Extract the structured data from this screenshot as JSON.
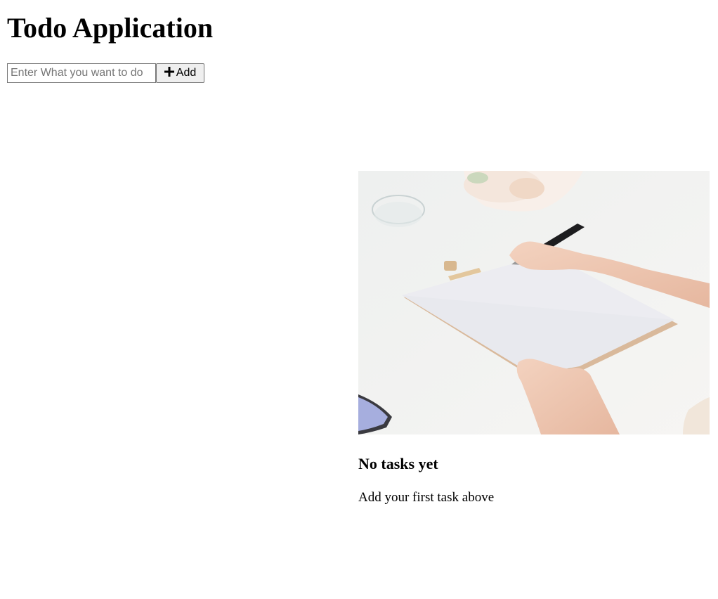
{
  "app": {
    "title": "Todo Application"
  },
  "form": {
    "input_placeholder": "Enter What you want to do",
    "input_value": "",
    "add_label": "Add",
    "add_icon": "plus-icon"
  },
  "empty_state": {
    "image": "illustration-hand-writing-on-clipboard",
    "title": "No tasks yet",
    "message": "Add your first task above"
  }
}
